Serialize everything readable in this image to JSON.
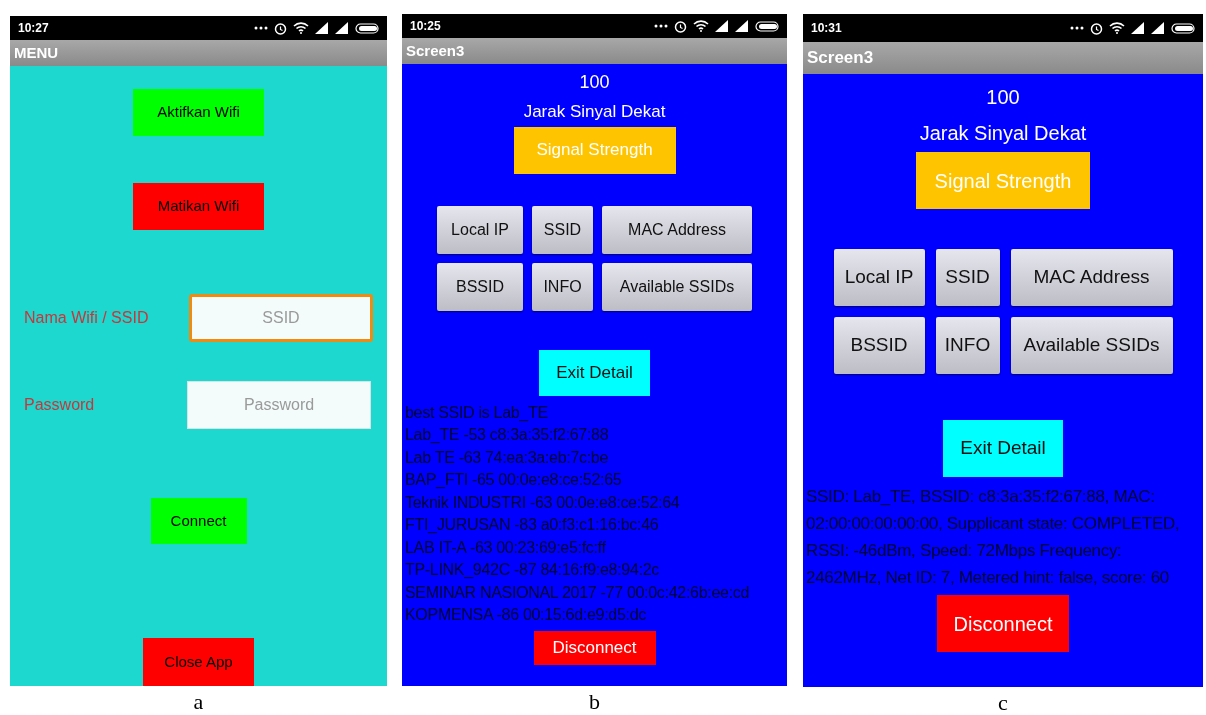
{
  "screens": [
    {
      "kind": "menu",
      "caption": "a",
      "status_time": "10:27",
      "title": "MENU",
      "wifi_on_button": "Aktifkan Wifi",
      "wifi_off_button": "Matikan Wifi",
      "ssid_label": "Nama Wifi / SSID",
      "ssid_field": {
        "placeholder": "SSID",
        "focused": true
      },
      "password_label": "Password",
      "password_field": {
        "placeholder": "Password",
        "focused": false
      },
      "connect_button": "Connect",
      "close_button": "Close App"
    },
    {
      "kind": "detail",
      "caption": "b",
      "status_time": "10:25",
      "title": "Screen3",
      "value": "100",
      "distance": "Jarak Sinyal Dekat",
      "signal_button": "Signal Strength",
      "buttons": [
        "Local IP",
        "SSID",
        "MAC Address",
        "BSSID",
        "INFO",
        "Available SSIDs"
      ],
      "exit_button": "Exit Detail",
      "output": [
        "best SSID is Lab_TE",
        "Lab_TE -53 c8:3a:35:f2:67:88",
        "Lab TE -63 74:ea:3a:eb:7c:be",
        "BAP_FTI -65 00:0e:e8:ce:52:65",
        "Teknik INDUSTRI -63 00:0e:e8:ce:52:64",
        "FTI_JURUSAN -83 a0:f3:c1:16:bc:46",
        "LAB IT-A -63 00:23:69:e5:fc:ff",
        "TP-LINK_942C -87 84:16:f9:e8:94:2c",
        "SEMINAR NASIONAL 2017 -77 00:0c:42:6b:ee:cd",
        "KOPMENSA -86 00:15:6d:e9:d5:dc"
      ],
      "disconnect_button": "Disconnect"
    },
    {
      "kind": "detail",
      "caption": "c",
      "status_time": "10:31",
      "title": "Screen3",
      "value": "100",
      "distance": "Jarak Sinyal Dekat",
      "signal_button": "Signal Strength",
      "buttons": [
        "Local IP",
        "SSID",
        "MAC Address",
        "BSSID",
        "INFO",
        "Available SSIDs"
      ],
      "exit_button": "Exit Detail",
      "output": [
        "SSID: Lab_TE, BSSID: c8:3a:35:f2:67:88, MAC: 02:00:00:00:00:00, Supplicant state: COMPLETED, RSSI: -46dBm, Speed: 72Mbps Frequency: 2462MHz, Net ID: 7, Metered hint: false, score: 60"
      ],
      "disconnect_button": "Disconnect"
    }
  ]
}
